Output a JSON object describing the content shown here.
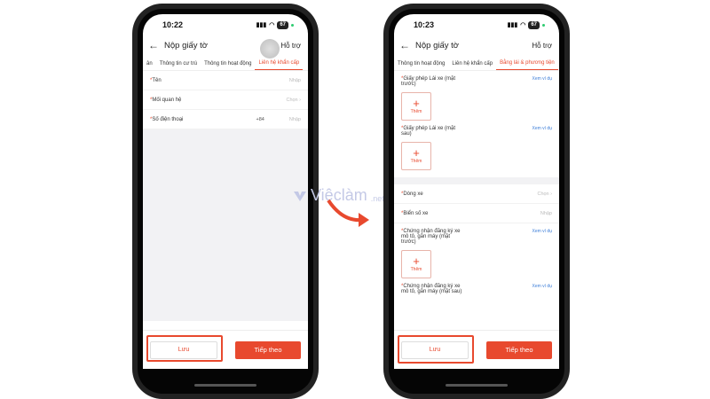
{
  "colors": {
    "accent": "#e8492e",
    "link": "#3b7dd8"
  },
  "left_phone": {
    "time": "10:22",
    "battery": "67",
    "title": "Nộp giấy tờ",
    "help": "Hỗ trợ",
    "tabs": [
      "ân",
      "Thông tin cư trú",
      "Thông tin hoạt động",
      "Liên hệ khẩn cấp"
    ],
    "fields": [
      {
        "label": "Tên",
        "value": "Nhập"
      },
      {
        "label": "Mối quan hệ",
        "value": "Chọn"
      },
      {
        "label": "Số điện thoại",
        "prefix": "+84",
        "value": "Nhập"
      }
    ],
    "save": "Lưu",
    "next": "Tiếp theo"
  },
  "right_phone": {
    "time": "10:23",
    "battery": "67",
    "title": "Nộp giấy tờ",
    "help": "Hỗ trợ",
    "tabs": [
      "Thông tin hoạt động",
      "Liên hệ khẩn cấp",
      "Bằng lái & phương tiện"
    ],
    "docs": [
      {
        "label": "Giấy phép Lái xe (mặt trước)",
        "example": "Xem ví dụ",
        "add": "Thêm"
      },
      {
        "label": "Giấy phép Lái xe (mặt sau)",
        "example": "Xem ví dụ",
        "add": "Thêm"
      }
    ],
    "fields": [
      {
        "label": "Dòng xe",
        "value": "Chọn"
      },
      {
        "label": "Biển số xe",
        "value": "Nhập"
      }
    ],
    "docs2": [
      {
        "label": "Chứng nhận đăng ký xe mô tô, gắn máy (mặt trước)",
        "example": "Xem ví dụ",
        "add": "Thêm"
      },
      {
        "label": "Chứng nhận đăng ký xe mô tô, gắn máy (mặt sau)",
        "example": "Xem ví dụ"
      }
    ],
    "save": "Lưu",
    "next": "Tiếp theo"
  },
  "watermark": {
    "main": "Việclàm",
    "suffix": ".net"
  }
}
